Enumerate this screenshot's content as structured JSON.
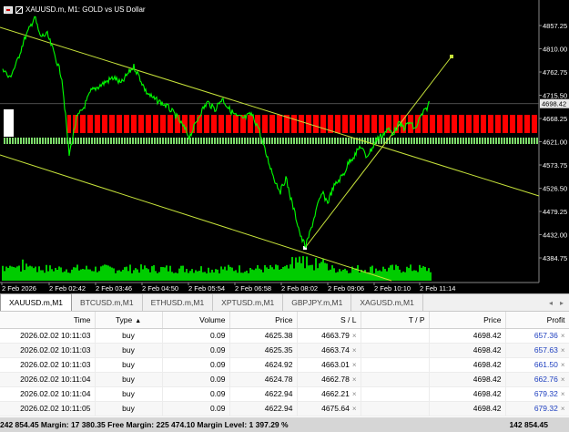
{
  "chart": {
    "title": "XAUUSD.m, M1:  GOLD vs US Dollar",
    "price_levels": [
      "4857.25",
      "4810.00",
      "4762.75",
      "4715.50",
      "4668.25",
      "4621.00",
      "4573.75",
      "4526.50",
      "4479.25",
      "4432.00",
      "4384.75"
    ],
    "current_price": "4698.42",
    "time_labels": [
      "2 Feb 2026",
      "2 Feb 02:42",
      "2 Feb 03:46",
      "2 Feb 04:50",
      "2 Feb 05:54",
      "2 Feb 06:58",
      "2 Feb 08:02",
      "2 Feb 09:06",
      "2 Feb 10:10",
      "2 Feb 11:14"
    ],
    "colors": {
      "background": "#000000",
      "candles": "#00ff00",
      "trendlines": "#c6e23a",
      "sell_markers": "#ff0000",
      "buy_markers": "#7ddc6b",
      "grid": "#666666"
    }
  },
  "tabs": [
    {
      "label": "XAUUSD.m,M1",
      "active": true
    },
    {
      "label": "BTCUSD.m,M1",
      "active": false
    },
    {
      "label": "ETHUSD.m,M1",
      "active": false
    },
    {
      "label": "XPTUSD.m,M1",
      "active": false
    },
    {
      "label": "GBPJPY.m,M1",
      "active": false
    },
    {
      "label": "XAGUSD.m,M1",
      "active": false
    }
  ],
  "tab_arrows": {
    "left": "◂",
    "right": "▸"
  },
  "table": {
    "columns": {
      "time": "Time",
      "type": "Type",
      "volume": "Volume",
      "price": "Price",
      "sl": "S / L",
      "tp": "T / P",
      "price2": "Price",
      "profit": "Profit"
    },
    "sort_indicator": "▲",
    "close_glyph": "×",
    "rows": [
      {
        "time": "2026.02.02 10:11:03",
        "type": "buy",
        "volume": "0.09",
        "price": "4625.38",
        "sl": "4663.79",
        "tp": "",
        "current": "4698.42",
        "profit": "657.36"
      },
      {
        "time": "2026.02.02 10:11:03",
        "type": "buy",
        "volume": "0.09",
        "price": "4625.35",
        "sl": "4663.74",
        "tp": "",
        "current": "4698.42",
        "profit": "657.63"
      },
      {
        "time": "2026.02.02 10:11:03",
        "type": "buy",
        "volume": "0.09",
        "price": "4624.92",
        "sl": "4663.01",
        "tp": "",
        "current": "4698.42",
        "profit": "661.50"
      },
      {
        "time": "2026.02.02 10:11:04",
        "type": "buy",
        "volume": "0.09",
        "price": "4624.78",
        "sl": "4662.78",
        "tp": "",
        "current": "4698.42",
        "profit": "662.76"
      },
      {
        "time": "2026.02.02 10:11:04",
        "type": "buy",
        "volume": "0.09",
        "price": "4622.94",
        "sl": "4662.21",
        "tp": "",
        "current": "4698.42",
        "profit": "679.32"
      },
      {
        "time": "2026.02.02 10:11:05",
        "type": "buy",
        "volume": "0.09",
        "price": "4622.94",
        "sl": "4675.64",
        "tp": "",
        "current": "4698.42",
        "profit": "679.32"
      }
    ],
    "summary": "242 854.45  Margin: 17 380.35  Free Margin: 225 474.10  Margin Level: 1 397.29 %",
    "total": "142 854.45"
  }
}
